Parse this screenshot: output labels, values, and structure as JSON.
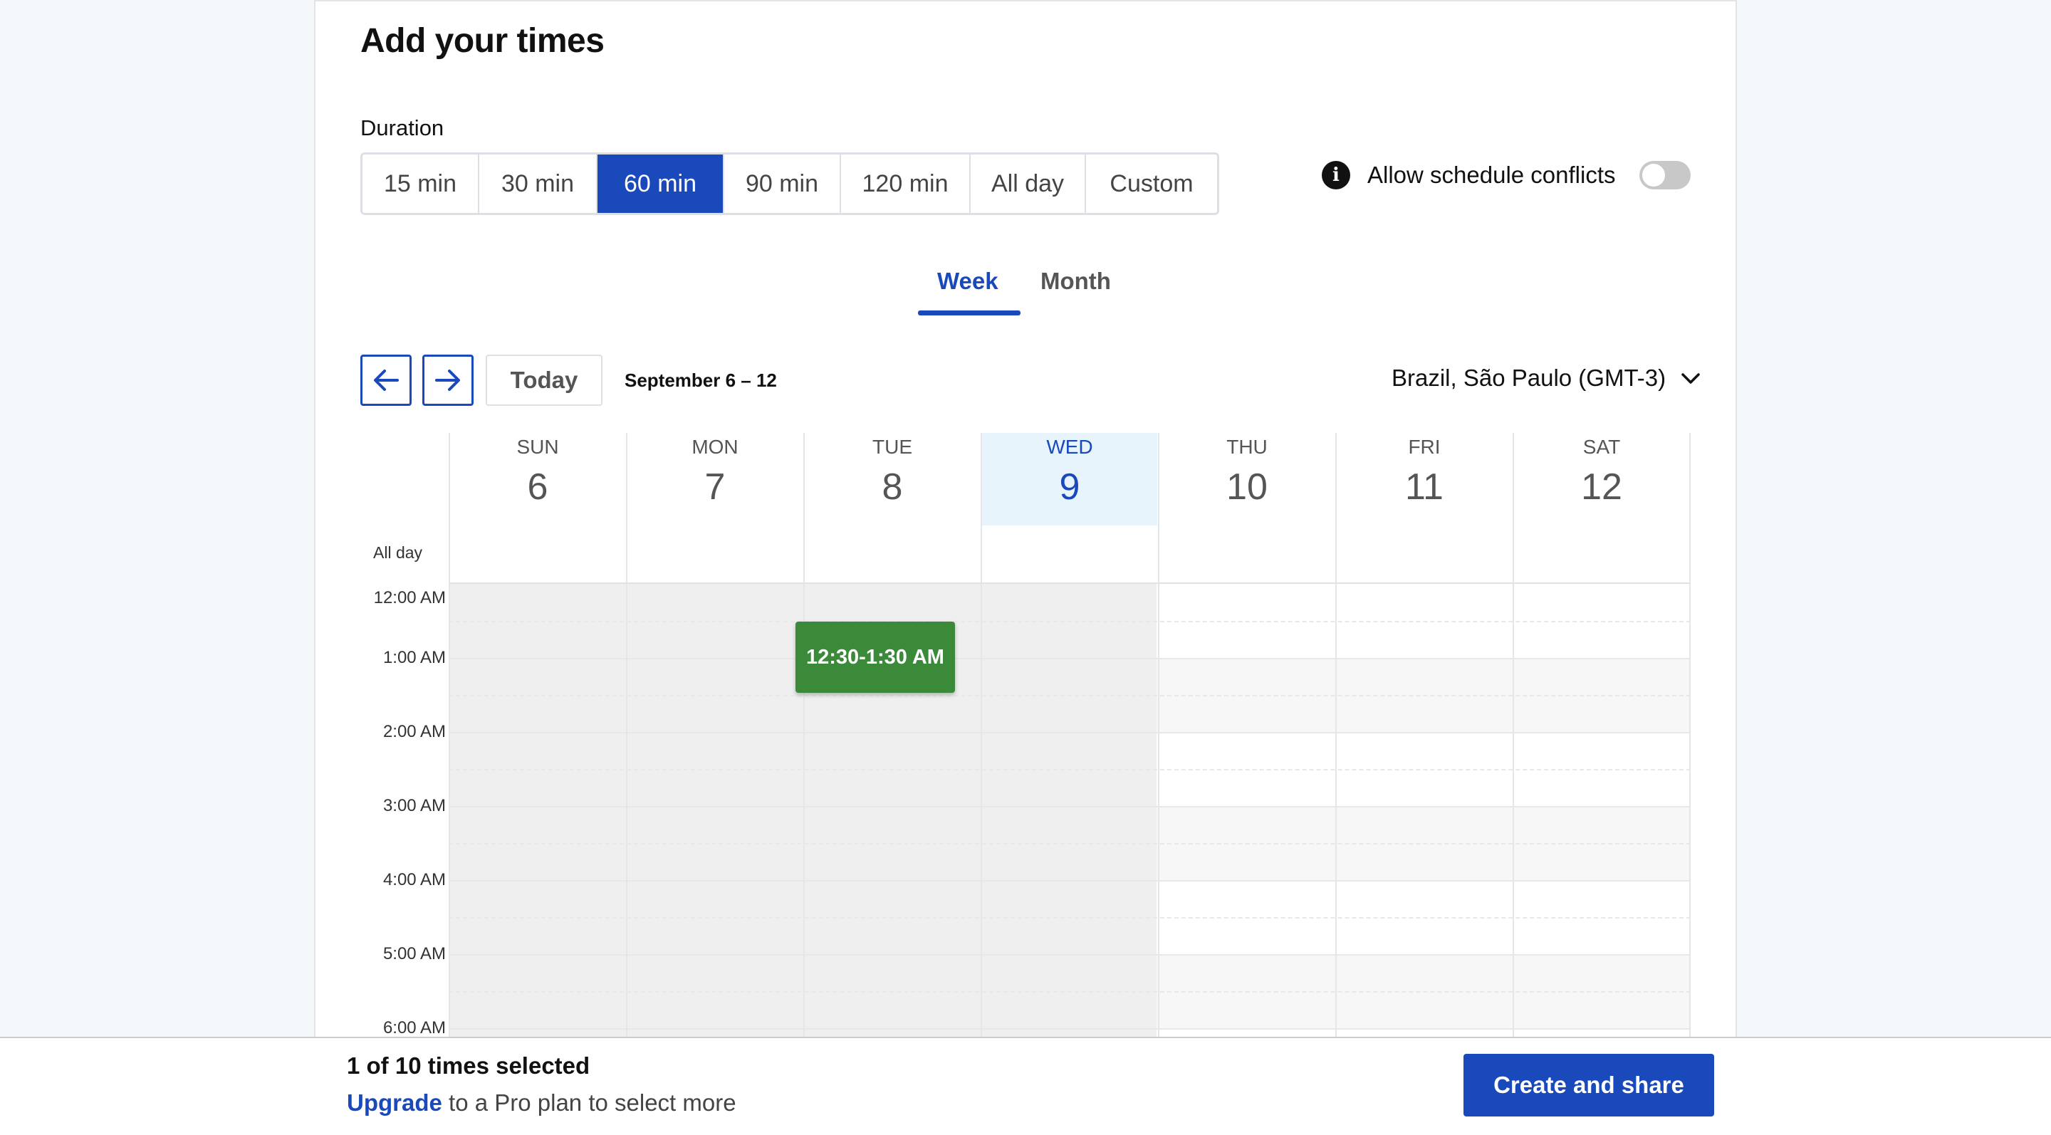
{
  "header": {
    "title": "Add your times"
  },
  "duration": {
    "label": "Duration",
    "options": [
      "15 min",
      "30 min",
      "60 min",
      "90 min",
      "120 min",
      "All day",
      "Custom"
    ],
    "selected": "60 min"
  },
  "conflicts": {
    "icon": "info-icon",
    "label": "Allow schedule conflicts",
    "enabled": false
  },
  "view_tabs": {
    "week": "Week",
    "month": "Month",
    "active": "Week"
  },
  "calendar": {
    "today_label": "Today",
    "range": "September 6 – 12",
    "timezone": "Brazil, São Paulo (GMT-3)",
    "all_day_label": "All day",
    "days": [
      {
        "name": "SUN",
        "num": "6"
      },
      {
        "name": "MON",
        "num": "7"
      },
      {
        "name": "TUE",
        "num": "8"
      },
      {
        "name": "WED",
        "num": "9"
      },
      {
        "name": "THU",
        "num": "10"
      },
      {
        "name": "FRI",
        "num": "11"
      },
      {
        "name": "SAT",
        "num": "12"
      }
    ],
    "today_index": 3,
    "times": [
      "12:00 AM",
      "1:00 AM",
      "2:00 AM",
      "3:00 AM",
      "4:00 AM",
      "5:00 AM",
      "6:00 AM"
    ],
    "event": {
      "label": "12:30-1:30 AM",
      "color": "#3b8a3a"
    }
  },
  "footer": {
    "selected_count": "1 of 10 times selected",
    "upgrade_link": "Upgrade",
    "upgrade_text": " to a Pro plan to select more",
    "create_button": "Create and share"
  },
  "colors": {
    "accent": "#1a49bb",
    "event": "#3b8a3a"
  }
}
